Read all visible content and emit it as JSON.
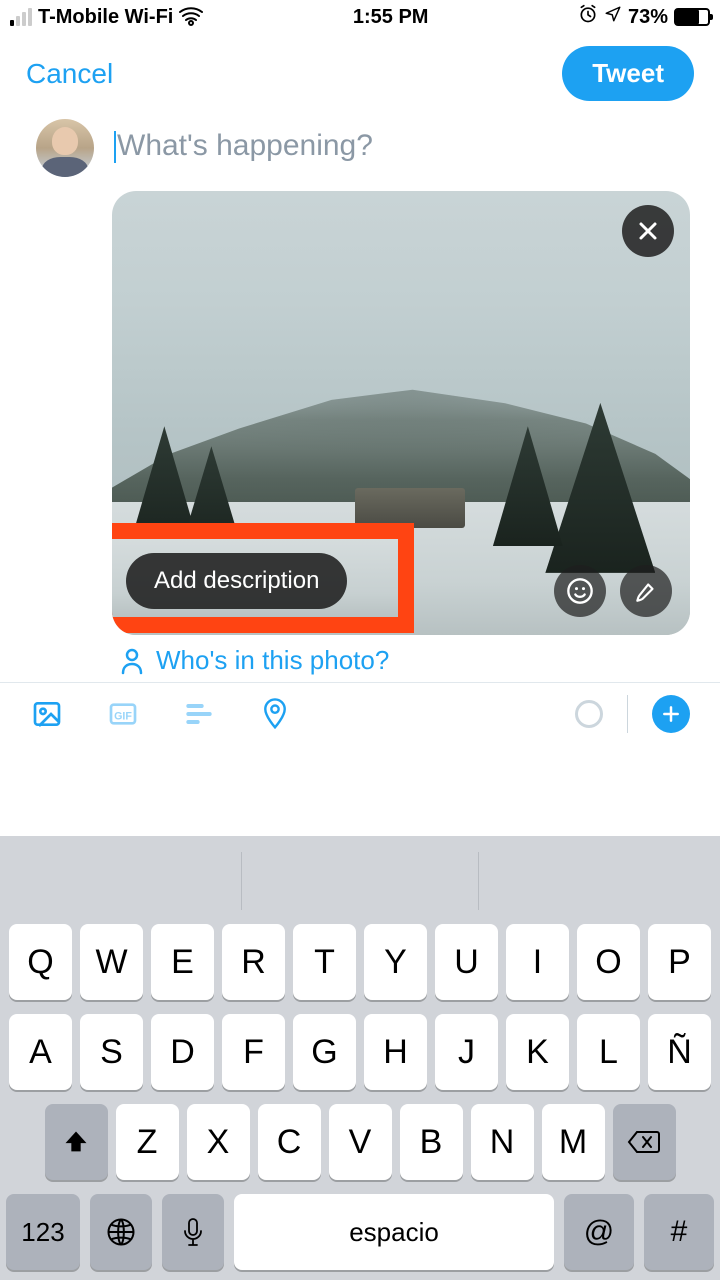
{
  "status": {
    "carrier": "T-Mobile Wi-Fi",
    "time": "1:55 PM",
    "battery_pct": "73%"
  },
  "nav": {
    "cancel": "Cancel",
    "tweet": "Tweet"
  },
  "compose": {
    "placeholder": "What's happening?"
  },
  "image": {
    "add_description": "Add description"
  },
  "tag": {
    "prompt": "Who's in this photo?"
  },
  "keyboard": {
    "row1": [
      "Q",
      "W",
      "E",
      "R",
      "T",
      "Y",
      "U",
      "I",
      "O",
      "P"
    ],
    "row2": [
      "A",
      "S",
      "D",
      "F",
      "G",
      "H",
      "J",
      "K",
      "L",
      "Ñ"
    ],
    "row3": [
      "Z",
      "X",
      "C",
      "V",
      "B",
      "N",
      "M"
    ],
    "numbers": "123",
    "space": "espacio",
    "at": "@",
    "hash": "#"
  }
}
